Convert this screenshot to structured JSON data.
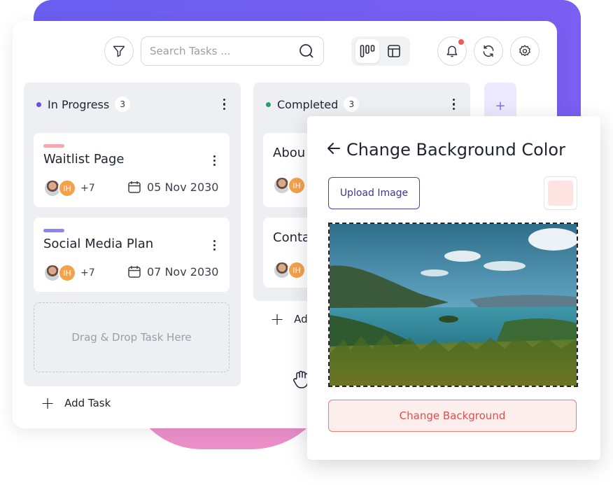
{
  "toolbar": {
    "search_placeholder": "Search Tasks ...",
    "filter_icon": "filter-icon",
    "search_icon": "search-icon",
    "views": [
      "kanban-view-icon",
      "table-view-icon"
    ],
    "actions": [
      "bell-icon",
      "refresh-icon",
      "gear-icon"
    ]
  },
  "columns": [
    {
      "title": "In Progress",
      "count": "3",
      "dot_color": "#6a4fe0",
      "cards": [
        {
          "title": "Waitlist Page",
          "tag_color": "#f6a6ad",
          "initials": "IH",
          "more": "+7",
          "date": "05 Nov 2030"
        },
        {
          "title": "Social Media Plan",
          "tag_color": "#8c84f5",
          "initials": "IH",
          "more": "+7",
          "date": "07 Nov 2030"
        }
      ],
      "drop_zone": "Drag & Drop Task Here",
      "add_task": "Add Task"
    },
    {
      "title": "Completed",
      "count": "3",
      "dot_color": "#2a9d6a",
      "cards": [
        {
          "title": "Abou",
          "initials": "IH"
        },
        {
          "title": "Conta",
          "initials": "IH"
        }
      ],
      "add_task": "Ad"
    }
  ],
  "add_column": "+",
  "modal": {
    "title": "Change Background Color",
    "upload_label": "Upload Image",
    "swatch_color": "#fde3e1",
    "change_label": "Change Background"
  },
  "colors": {
    "accent_purple": "#6a5ef0",
    "pink_decor": "#ec8fc9",
    "danger_text": "#e0504b"
  }
}
